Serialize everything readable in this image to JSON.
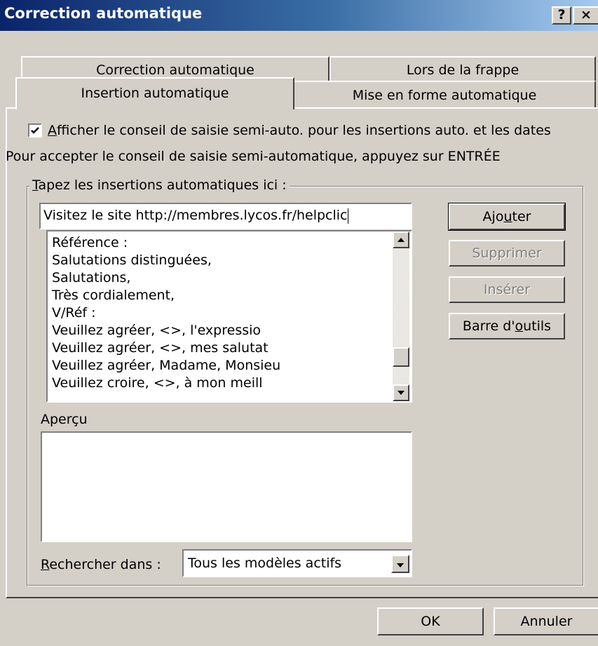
{
  "window": {
    "title": "Correction automatique",
    "help_label": "?",
    "close_label": "×"
  },
  "tabs": {
    "back_row": [
      "Correction automatique",
      "Lors de la frappe"
    ],
    "front_row": [
      "Insertion automatique",
      "Mise en forme automatique"
    ],
    "active": "Insertion automatique"
  },
  "options": {
    "show_tip_checked": true,
    "show_tip_label_first": "A",
    "show_tip_label_rest": "fficher le conseil de saisie semi-auto. pour les insertions auto. et les dates",
    "accept_hint": "Pour accepter le conseil de saisie semi-automatique, appuyez sur ENTRÉE"
  },
  "group": {
    "label_first": "T",
    "label_rest": "apez les insertions automatiques ici :"
  },
  "entry": {
    "value": "Visitez le site http://membres.lycos.fr/helpclic"
  },
  "list": {
    "items": [
      "Référence :",
      "Salutations distinguées,",
      "Salutations,",
      "Très cordialement,",
      "V/Réf :",
      "Veuillez agréer, <>, l'expressio",
      "Veuillez agréer, <>, mes salutat",
      "Veuillez agréer, Madame, Monsieu",
      "Veuillez croire, <>, à mon meill"
    ],
    "scroll_fraction": 0.85
  },
  "buttons": {
    "add_pre": "Ajo",
    "add_u": "u",
    "add_post": "ter",
    "delete": "Supprimer",
    "insert": "Insérer",
    "toolbar_pre": "Barre d'",
    "toolbar_u": "o",
    "toolbar_post": "utils",
    "ok": "OK",
    "cancel": "Annuler"
  },
  "preview": {
    "label": "Aperçu"
  },
  "search": {
    "label_first": "R",
    "label_rest": "echercher dans :",
    "value": "Tous les modèles actifs"
  }
}
